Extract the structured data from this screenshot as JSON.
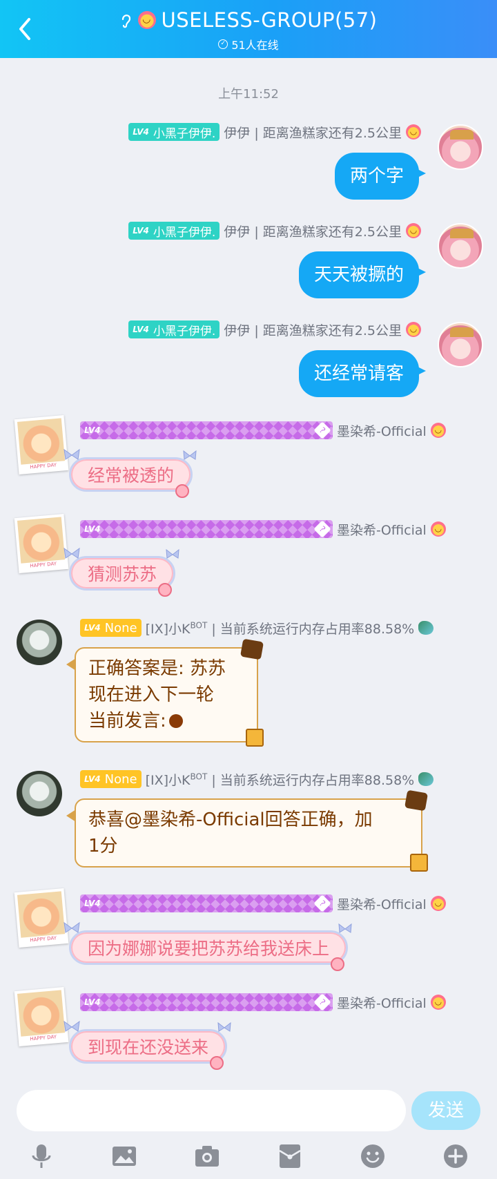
{
  "header": {
    "title": "USELESS-GROUP(57)",
    "online": "51人在线"
  },
  "chat": {
    "timestamp": "上午11:52",
    "messages": [
      {
        "side": "right",
        "level": "LV4",
        "title_tag": "小黑子伊伊.",
        "name": "伊伊 | 距离渔糕家还有2.5公里",
        "text": "两个字"
      },
      {
        "side": "right",
        "level": "LV4",
        "title_tag": "小黑子伊伊.",
        "name": "伊伊 | 距离渔糕家还有2.5公里",
        "text": "天天被撅的"
      },
      {
        "side": "right",
        "level": "LV4",
        "title_tag": "小黑子伊伊.",
        "name": "伊伊 | 距离渔糕家还有2.5公里",
        "text": "还经常请客"
      },
      {
        "side": "left",
        "level": "LV4",
        "name": "墨染希-Official",
        "text": "经常被透的"
      },
      {
        "side": "left",
        "level": "LV4",
        "name": "墨染希-Official",
        "text": "猜测苏苏"
      },
      {
        "side": "left",
        "level": "LV4",
        "title_tag": "None",
        "name_prefix": "[IX]小K",
        "name_sup": "BOT",
        "name_suffix": " | 当前系统运行内存占用率88.58%",
        "lines": [
          "正确答案是: 苏苏",
          "现在进入下一轮",
          "当前发言:"
        ]
      },
      {
        "side": "left",
        "level": "LV4",
        "title_tag": "None",
        "name_prefix": "[IX]小K",
        "name_sup": "BOT",
        "name_suffix": " | 当前系统运行内存占用率88.58%",
        "lines": [
          "恭喜@墨染希-Official回答正确，加",
          "1分"
        ]
      },
      {
        "side": "left",
        "level": "LV4",
        "name": "墨染希-Official",
        "text": "因为娜娜说要把苏苏给我送床上"
      },
      {
        "side": "left",
        "level": "LV4",
        "name": "墨染希-Official",
        "text": "到现在还没送来"
      }
    ]
  },
  "composer": {
    "placeholder": "",
    "send_label": "发送"
  },
  "frame_caption": "HAPPY DAY",
  "icons": [
    "back-icon",
    "ear-icon",
    "group-emoji-icon",
    "online-icon",
    "mic-icon",
    "image-icon",
    "camera-icon",
    "red-packet-icon",
    "emoji-icon",
    "plus-icon"
  ],
  "colors": {
    "header_start": "#12c5f5",
    "header_end": "#3a8ef8",
    "bubble_blue": "#15a8f5",
    "bubble_pink_text": "#ec6d85",
    "note_text": "#7a3a00",
    "tag_teal": "#2ed3c5",
    "tag_yellow": "#ffc425",
    "tag_purple": "#c66be8"
  }
}
